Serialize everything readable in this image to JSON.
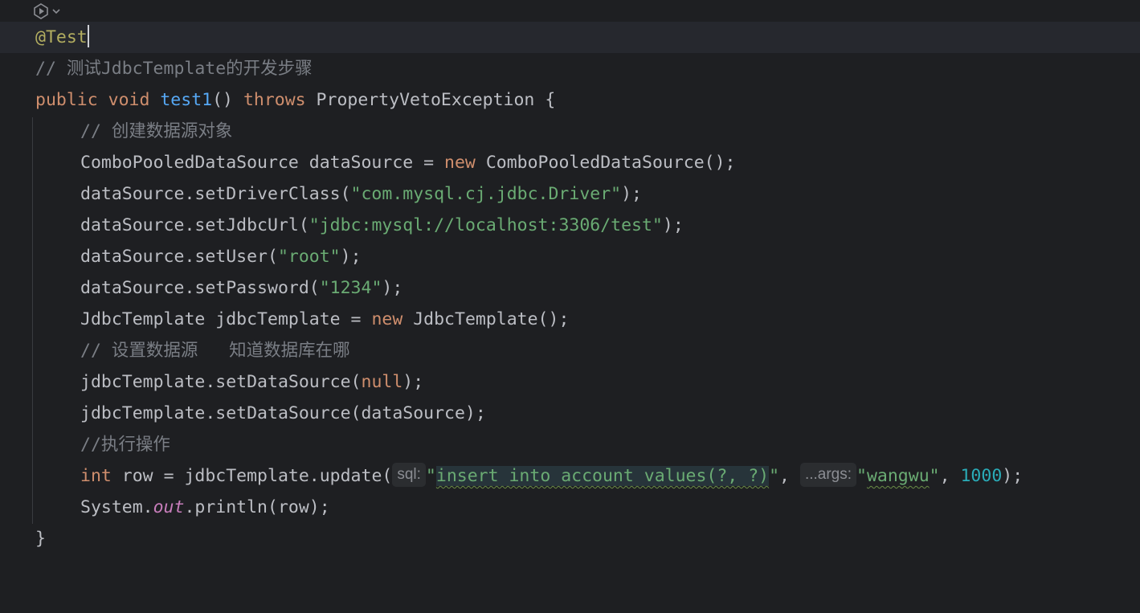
{
  "gutter": {
    "icon": "test-run-icon",
    "chevron": "chevron-down-icon"
  },
  "lines": {
    "annotation": "@Test",
    "comment1": "// 测试JdbcTemplate的开发步骤",
    "sig_public": "public",
    "sig_void": "void",
    "sig_name": "test1",
    "sig_parens": "()",
    "sig_throws": "throws",
    "sig_rest": " PropertyVetoException {",
    "comment2": "// 创建数据源对象",
    "l5_a": "ComboPooledDataSource dataSource = ",
    "l5_new": "new",
    "l5_b": " ComboPooledDataSource();",
    "l6_a": "dataSource.setDriverClass(",
    "l6_str": "\"com.mysql.cj.jdbc.Driver\"",
    "l6_b": ");",
    "l7_a": "dataSource.setJdbcUrl(",
    "l7_str": "\"jdbc:mysql://localhost:3306/test\"",
    "l7_b": ");",
    "l8_a": "dataSource.setUser(",
    "l8_str": "\"root\"",
    "l8_b": ");",
    "l9_a": "dataSource.setPassword(",
    "l9_str": "\"1234\"",
    "l9_b": ");",
    "l10_a": "JdbcTemplate jdbcTemplate = ",
    "l10_new": "new",
    "l10_b": " JdbcTemplate();",
    "comment3": "// 设置数据源   知道数据库在哪",
    "l12_a": "jdbcTemplate.setDataSource(",
    "l12_null": "null",
    "l12_b": ");",
    "l13": "jdbcTemplate.setDataSource(dataSource);",
    "comment4": "//执行操作",
    "l15_int": "int",
    "l15_a": " row = jdbcTemplate.update(",
    "hint_sql": "sql:",
    "l15_q1": "\"",
    "l15_sql": "insert into account values(?, ?)",
    "l15_q2": "\"",
    "l15_comma": ", ",
    "hint_args": "...args:",
    "l15_q3": "\"",
    "l15_wang": "wangwu",
    "l15_q4": "\"",
    "l15_sep": ", ",
    "l15_num": "1000",
    "l15_end": ");",
    "l16_a": "System.",
    "l16_out": "out",
    "l16_b": ".println(row);",
    "closing": "}"
  }
}
